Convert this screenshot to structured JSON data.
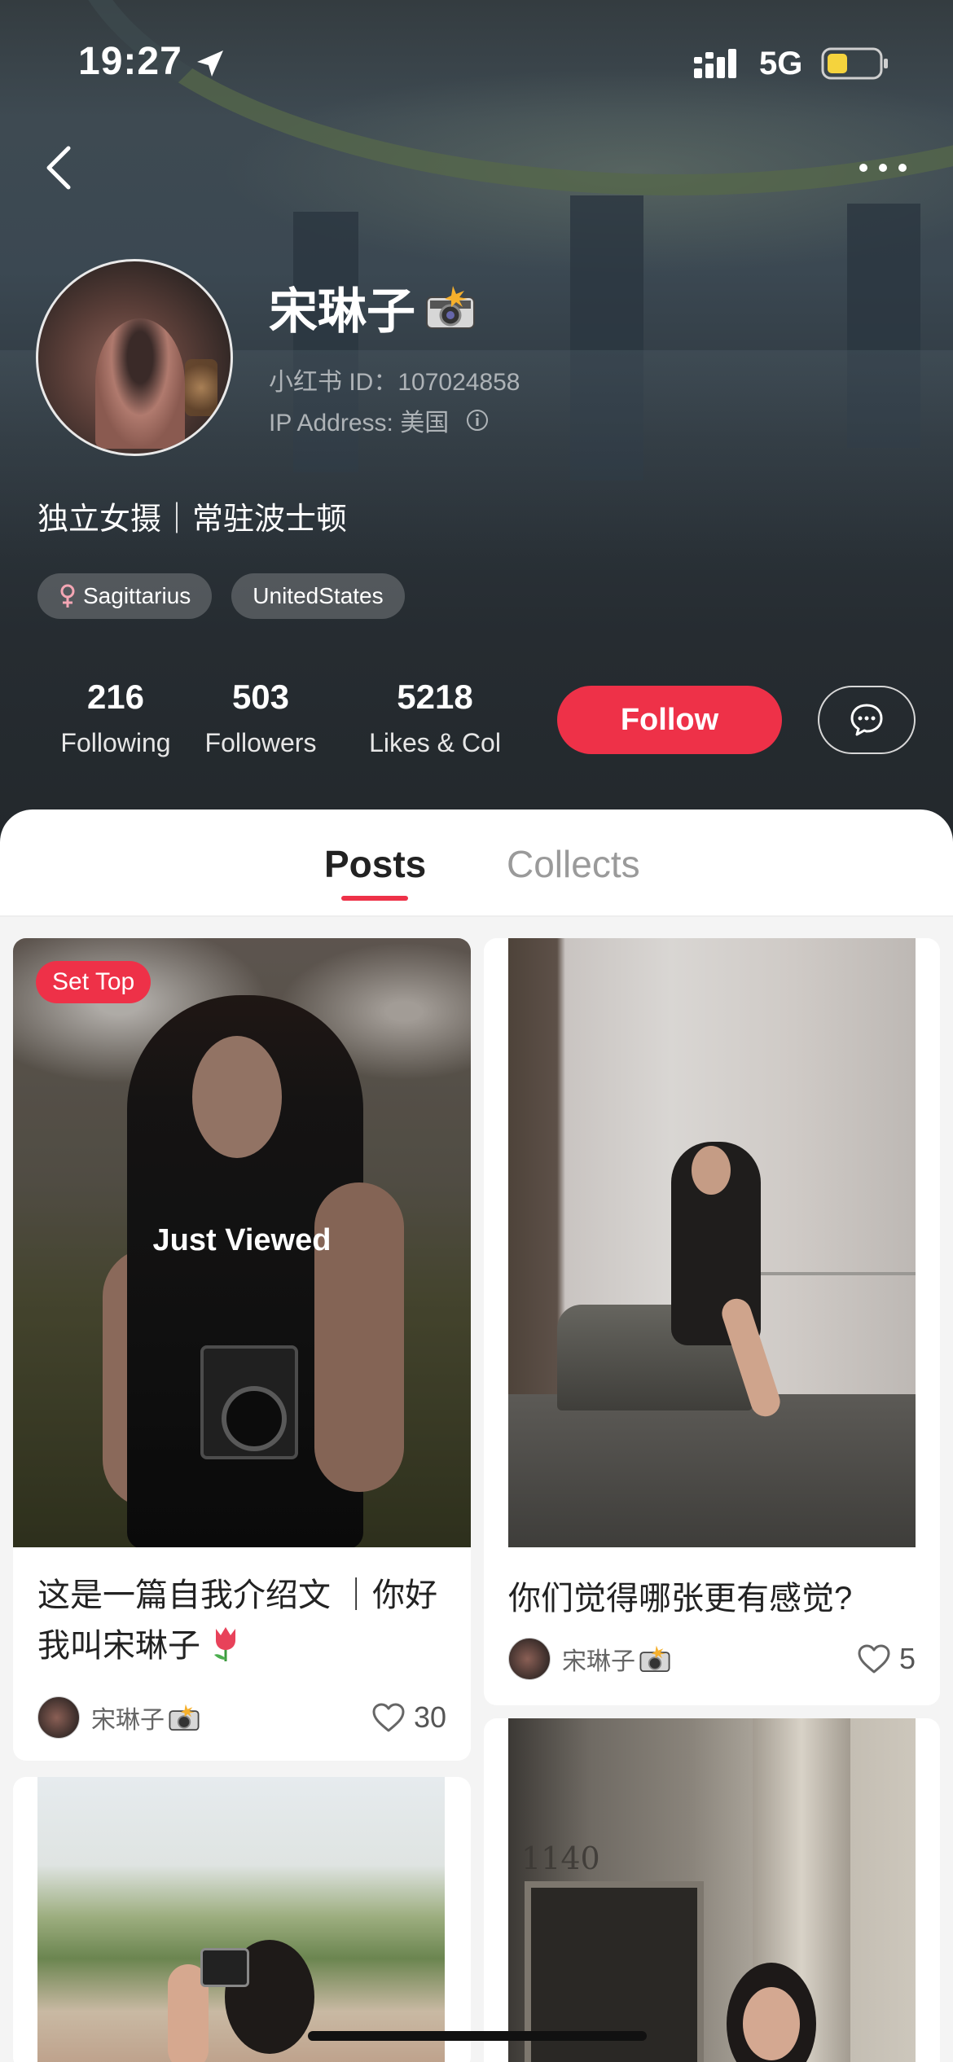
{
  "status_bar": {
    "time": "19:27",
    "network": "5G",
    "icons": [
      "location-arrow-icon",
      "signal-icon",
      "battery-icon"
    ],
    "battery_color": "#f5d33d"
  },
  "nav": {
    "back_icon": "chevron-left-icon",
    "more_icon": "more-dots-icon"
  },
  "profile": {
    "name": "宋琳子",
    "name_emoji": "camera-flash-emoji-icon",
    "id_text": "小红书 ID：107024858",
    "ip_text": "IP Address: 美国",
    "bio": "独立女摄｜常驻波士顿",
    "tags": [
      {
        "icon": "female-icon",
        "label": "Sagittarius"
      },
      {
        "label": "UnitedStates"
      }
    ],
    "stats": [
      {
        "value": "216",
        "label": "Following"
      },
      {
        "value": "503",
        "label": "Followers"
      },
      {
        "value": "5218",
        "label": "Likes & Col"
      }
    ],
    "follow_label": "Follow",
    "chat_icon": "chat-bubble-icon"
  },
  "tabs": [
    {
      "label": "Posts",
      "active": true
    },
    {
      "label": "Collects",
      "active": false
    }
  ],
  "feed": [
    {
      "badge": "Set Top",
      "overlay": "Just Viewed",
      "title": "这是一篇自我介绍文 ｜你好我叫宋琳子",
      "title_emoji": "tulip-icon",
      "author": "宋琳子",
      "likes": "30"
    },
    {
      "title": "你们觉得哪张更有感觉?",
      "author": "宋琳子",
      "likes": "5"
    },
    {
      "photo_text": ""
    },
    {
      "photo_text": "1140"
    }
  ],
  "colors": {
    "accent": "#ee3148",
    "header_bg": "#262c31"
  }
}
